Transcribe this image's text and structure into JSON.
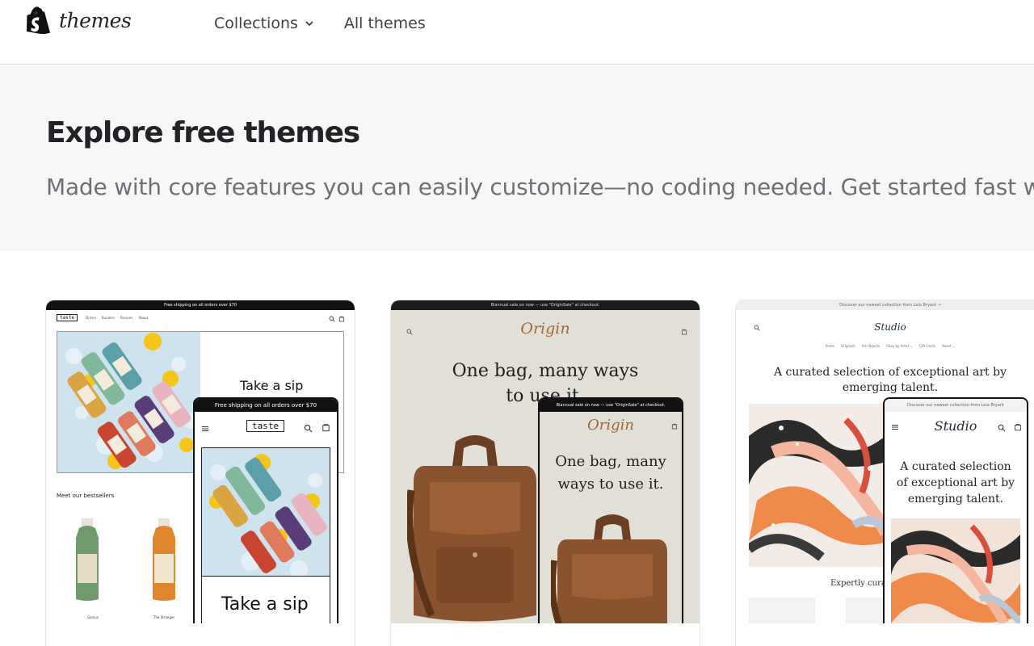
{
  "header": {
    "logo_text": "themes",
    "nav": [
      {
        "label": "Collections",
        "has_dropdown": true
      },
      {
        "label": "All themes",
        "has_dropdown": false
      }
    ]
  },
  "hero": {
    "title": "Explore free themes",
    "subtitle": "Made with core features you can easily customize—no coding needed. Get started fast wit"
  },
  "cards": [
    {
      "theme": "Taste",
      "announcement": "Free shipping on all orders over $70",
      "logo": "taste",
      "nav_links": [
        "Drinks",
        "Bundles",
        "Recipes",
        "About"
      ],
      "hero_title": "Take a sip",
      "section_title": "Meet our bestsellers",
      "products": [
        "Genius",
        "The Stranger"
      ],
      "mobile_announcement": "Free shipping on all orders over $70",
      "mobile_logo": "taste",
      "mobile_title": "Take a sip",
      "accent_color": "#111111"
    },
    {
      "theme": "Origin",
      "announcement": "Biannual sale on now — use \"OriginSale\" at checkout.",
      "logo": "Origin",
      "headline_line1": "One bag, many ways",
      "headline_line2": "to use it.",
      "mobile_announcement": "Biannual sale on now — use \"OriginSale\" at checkout.",
      "mobile_logo": "Origin",
      "mobile_headline_line1": "One bag, many",
      "mobile_headline_line2": "ways to use it.",
      "accent_color": "#a0673a",
      "background_color": "#e2dfd6"
    },
    {
      "theme": "Studio",
      "announcement": "Discover our newest collection from Leia Bryant →",
      "logo": "Studio",
      "nav_links": [
        "Prints",
        "Originals",
        "Art Objects",
        "Shop by Artist ⌄",
        "Gift Cards",
        "About ⌄"
      ],
      "headline_line1": "A curated selection of exceptional art by",
      "headline_line2": "emerging talent.",
      "subheading": "Expertly curate",
      "mobile_announcement": "Discover our newest collection from Leia Bryant",
      "mobile_logo": "Studio",
      "mobile_headline_line1": "A curated selection",
      "mobile_headline_line2": "of exceptional art by",
      "mobile_headline_line3": "emerging talent.",
      "accent_color": "#1e2a3a"
    }
  ],
  "icons": {
    "brand": "shopify-bag-icon",
    "dropdown": "chevron-down-icon",
    "search": "search-icon",
    "cart": "cart-icon",
    "menu": "hamburger-menu-icon"
  },
  "colors": {
    "text": "#212326",
    "muted": "#6d7175",
    "hero_background": "#f7f7f7",
    "brand_icon": "#111111"
  }
}
